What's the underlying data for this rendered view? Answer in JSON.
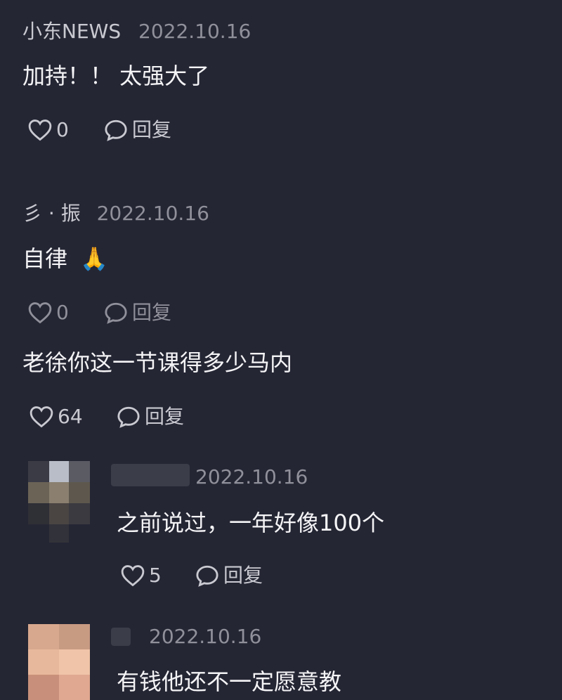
{
  "comments": [
    {
      "author": "小东NEWS",
      "date": "2022.10.16",
      "text": "加持！！ 太强大了",
      "likes": "0",
      "reply_label": "回复"
    },
    {
      "author": "彡 · 振",
      "date": "2022.10.16",
      "text": "自律",
      "emoji": "🙏",
      "likes": "0",
      "reply_label": "回复"
    },
    {
      "text": "老徐你这一节课得多少马内",
      "likes": "64",
      "reply_label": "回复",
      "replies": [
        {
          "date": "2022.10.16",
          "text": "之前说过，一年好像100个",
          "likes": "5",
          "reply_label": "回复"
        },
        {
          "date": "2022.10.16",
          "text": "有钱他还不一定愿意教"
        }
      ]
    }
  ],
  "colors": {
    "background": "#252634",
    "text": "#f4f4f6",
    "muted": "#8f909a"
  },
  "icons": [
    "heart-icon",
    "comment-bubble-icon"
  ]
}
